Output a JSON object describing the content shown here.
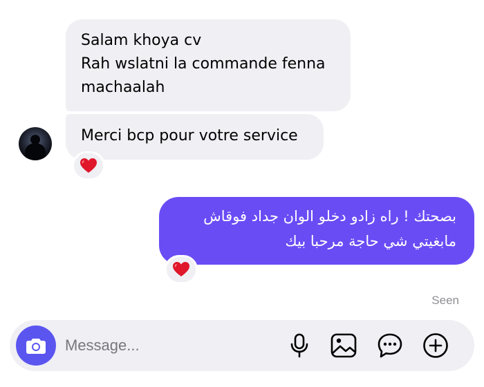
{
  "messages": {
    "incoming": [
      {
        "lines": [
          "Salam khoya cv",
          "Rah wslatni la commande fenna",
          "machaalah"
        ]
      },
      {
        "lines": [
          "Merci bcp pour votre service"
        ],
        "reaction": "❤️"
      }
    ],
    "outgoing": [
      {
        "lines": [
          "بصحتك ! راه زادو دخلو الوان جداد فوقاش",
          "مابغيتي شي حاجة مرحبا بيك"
        ],
        "reaction": "❤️",
        "status": "Seen"
      }
    ]
  },
  "composer": {
    "placeholder": "Message...",
    "icons": [
      "camera-icon",
      "microphone-icon",
      "image-icon",
      "sticker-icon",
      "plus-icon"
    ],
    "accent_color": "#5b55f0"
  },
  "colors": {
    "incoming_bubble": "#efeff4",
    "outgoing_bubble": "#6a4cf5",
    "reaction_heart": "#e0162b"
  }
}
